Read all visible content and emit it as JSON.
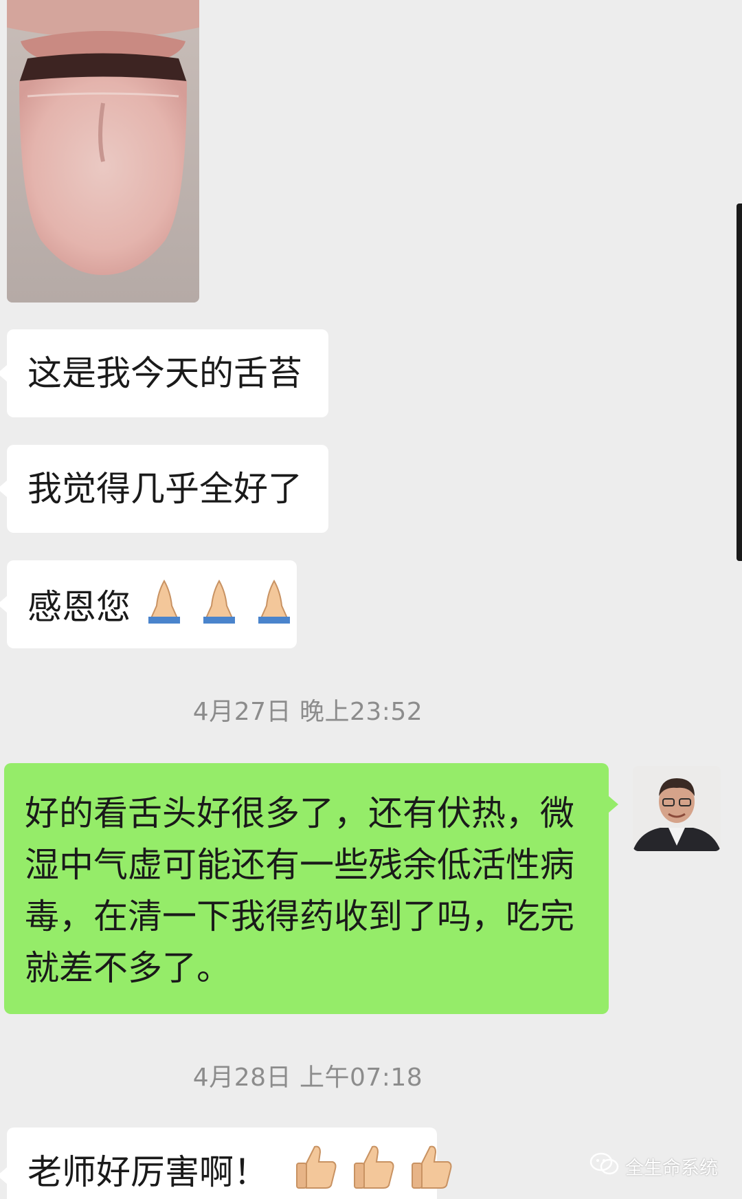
{
  "messages": [
    {
      "kind": "image",
      "alt": ""
    },
    {
      "kind": "text",
      "text": "这是我今天的舌苔"
    },
    {
      "kind": "text",
      "text": "我觉得几乎全好了"
    },
    {
      "kind": "text",
      "text": "感恩您",
      "emoji": "pray-icon",
      "emoji_count": 3
    }
  ],
  "timestamps": [
    "4月27日 晚上23:52",
    "4月28日 上午07:18"
  ],
  "reply": {
    "text": "好的看舌头好很多了，还有伏热，微湿中气虚可能还有一些残余低活性病毒，在清一下我得药收到了吗，吃完就差不多了。"
  },
  "last_message": {
    "text": "老师好厉害啊！",
    "emoji": "thumbs-up-icon",
    "emoji_count": 3
  },
  "watermark": {
    "text": "全生命系统",
    "icon": "wechat-icon"
  },
  "colors": {
    "background": "#ededed",
    "bubble_incoming": "#ffffff",
    "bubble_outgoing": "#95ec69",
    "timestamp": "#8c8c8c"
  }
}
